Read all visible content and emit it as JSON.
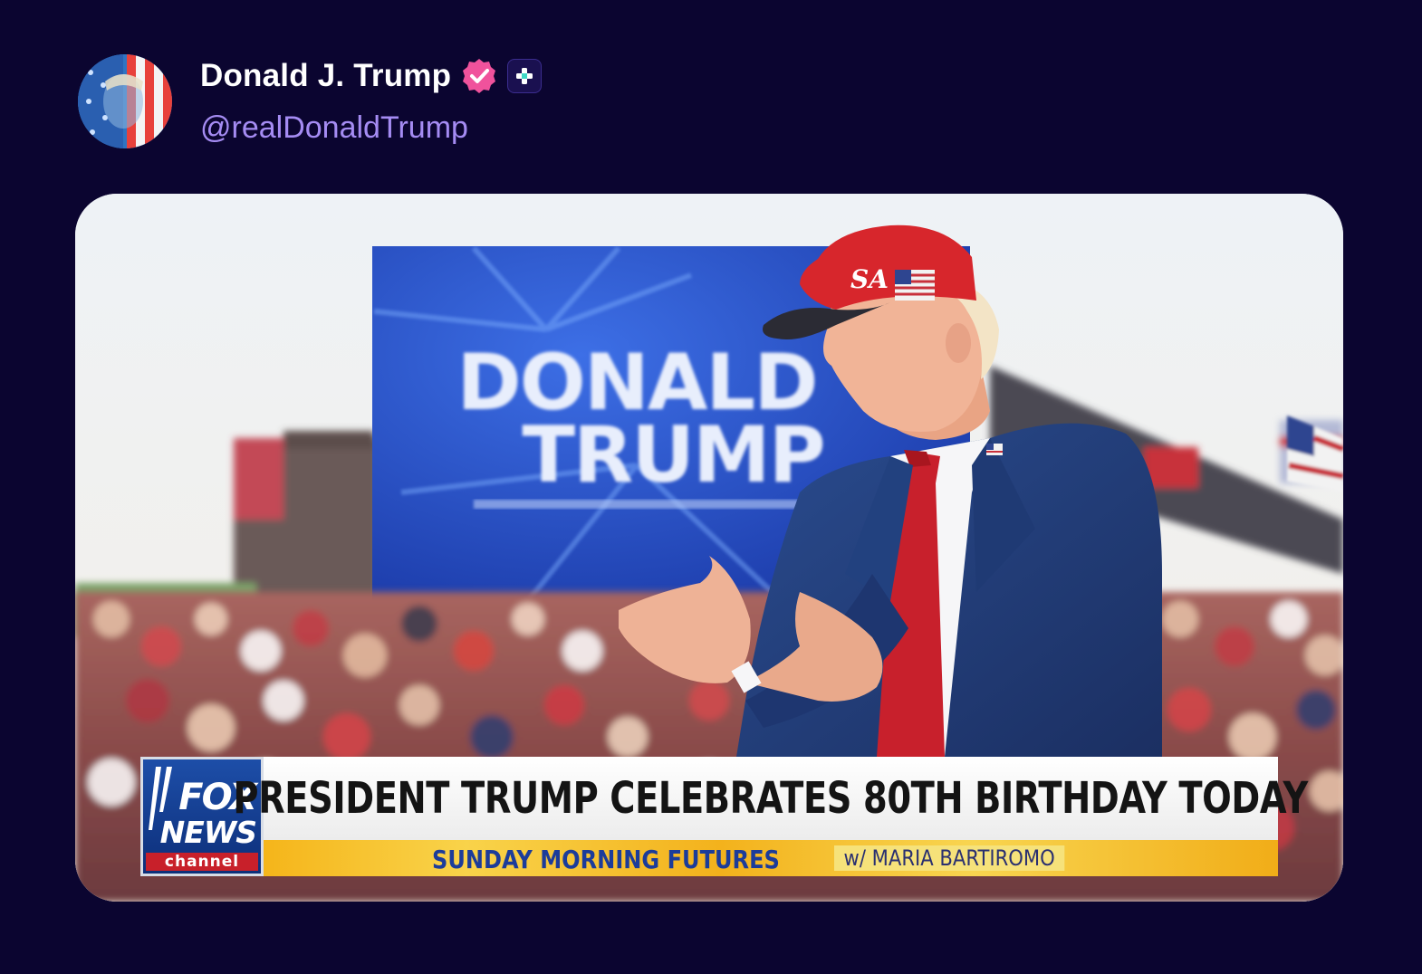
{
  "post": {
    "author": {
      "display_name": "Donald J. Trump",
      "handle": "@realDonaldTrump",
      "verified_icon": "verified-badge-icon",
      "plus_icon": "plus-badge-icon"
    },
    "media": {
      "type": "video-still",
      "backdrop_sign": {
        "line1": "DONALD",
        "line2": "TRUMP"
      },
      "chyron": {
        "network_logo_top": "FOX",
        "network_logo_bottom": "NEWS",
        "network_logo_channel": "channel",
        "headline": "PRESIDENT TRUMP CELEBRATES 80TH BIRTHDAY TODAY",
        "show_name": "SUNDAY MORNING FUTURES",
        "host": "w/ MARIA BARTIROMO"
      }
    }
  },
  "colors": {
    "background": "#0b0530",
    "handle": "#a58cf3",
    "verified": "#f0529c",
    "headline_bar": "#ffffff",
    "sub_bar": "#f5b51a"
  }
}
